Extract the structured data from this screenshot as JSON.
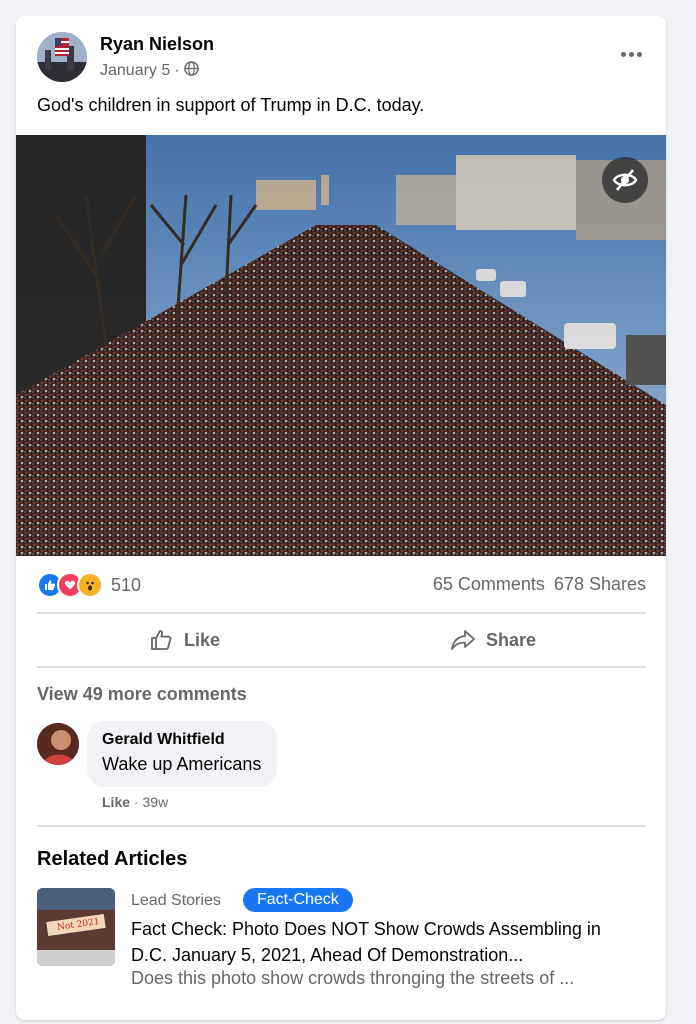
{
  "post": {
    "author": "Ryan Nielson",
    "date": "January 5",
    "privacy_icon": "globe-icon",
    "text": "God's children in support of Trump in D.C. today.",
    "more_icon": "more-options-icon",
    "photo_overlay_icon": "eye-slash-icon"
  },
  "reactions": {
    "icons": [
      "like-reaction-icon",
      "love-reaction-icon",
      "wow-reaction-icon"
    ],
    "count": "510",
    "comments": "65 Comments",
    "shares": "678 Shares"
  },
  "actions": {
    "like_label": "Like",
    "share_label": "Share"
  },
  "comments": {
    "view_more": "View 49 more comments",
    "items": [
      {
        "author": "Gerald Whitfield",
        "text": "Wake up Americans",
        "like_label": "Like",
        "separator": "·",
        "time": "39w"
      }
    ]
  },
  "related": {
    "heading": "Related Articles",
    "articles": [
      {
        "source": "Lead Stories",
        "badge": "Fact-Check",
        "thumb_stamp": "Not 2021",
        "title": "Fact Check: Photo Does NOT Show Crowds Assembling in D.C. January 5, 2021, Ahead Of Demonstration...",
        "description": "Does this photo show crowds thronging the streets of ..."
      }
    ]
  },
  "colors": {
    "accent": "#1877f2",
    "secondary_text": "#65676b",
    "page_bg": "#f0f2f5"
  }
}
